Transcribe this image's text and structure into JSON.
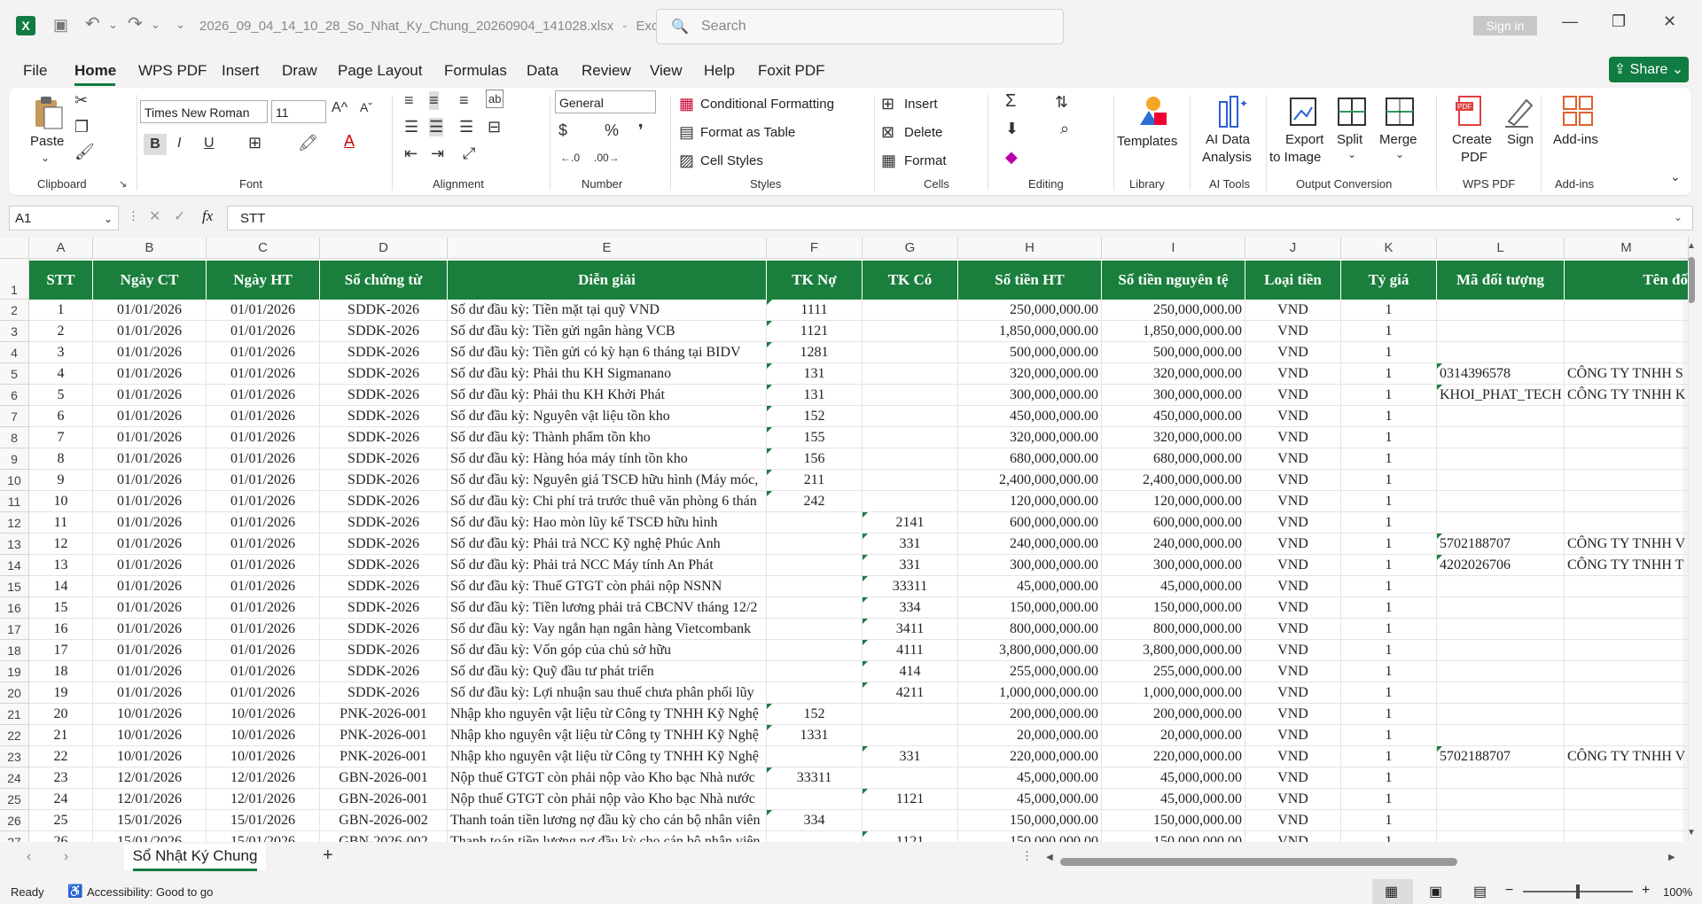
{
  "titlebar": {
    "app_icon": "X",
    "filename": "2026_09_04_14_10_28_So_Nhat_Ky_Chung_20260904_141028.xlsx",
    "separator": "-",
    "app_name": "Excel",
    "search_placeholder": "Search",
    "search_icon": "🔍",
    "signin": "Sign in",
    "save_icon": "▣",
    "undo_icon": "↶",
    "redo_icon": "↷",
    "dropdown_icon": "⌄",
    "min": "—",
    "max": "❐",
    "close": "✕"
  },
  "menu": {
    "items": [
      "File",
      "Home",
      "WPS PDF",
      "Insert",
      "Draw",
      "Page Layout",
      "Formulas",
      "Data",
      "Review",
      "View",
      "Help",
      "Foxit PDF"
    ],
    "active": "Home",
    "share": "Share"
  },
  "ribbon": {
    "clipboard": {
      "paste": "Paste",
      "label": "Clipboard"
    },
    "font": {
      "name": "Times New Roman",
      "size": "11",
      "label": "Font",
      "bold": "B",
      "italic": "I",
      "underline": "U",
      "grow": "A^",
      "shrink": "Aˇ"
    },
    "alignment": {
      "label": "Alignment"
    },
    "number": {
      "format": "General",
      "label": "Number",
      "currency": "$",
      "percent": "%",
      "comma": "❜"
    },
    "styles": {
      "conditional": "Conditional Formatting",
      "format_table": "Format as Table",
      "cell_styles": "Cell Styles",
      "label": "Styles"
    },
    "cells": {
      "insert": "Insert",
      "delete": "Delete",
      "format": "Format",
      "label": "Cells"
    },
    "editing": {
      "label": "Editing"
    },
    "library": {
      "templates": "Templates",
      "label": "Library"
    },
    "ai": {
      "line1": "AI Data",
      "line2": "Analysis",
      "label": "AI Tools"
    },
    "output": {
      "export1": "Export",
      "export2": "to Image",
      "split": "Split",
      "merge": "Merge",
      "label": "Output Conversion"
    },
    "wpspdf": {
      "create1": "Create",
      "create2": "PDF",
      "sign": "Sign",
      "label": "WPS PDF"
    },
    "addins": {
      "btn": "Add-ins",
      "label": "Add-ins"
    }
  },
  "formula": {
    "namebox": "A1",
    "fx": "fx",
    "value": "STT"
  },
  "columns": [
    "A",
    "B",
    "C",
    "D",
    "E",
    "F",
    "G",
    "H",
    "I",
    "J",
    "K",
    "L",
    "M"
  ],
  "headers": [
    "STT",
    "Ngày CT",
    "Ngày HT",
    "Số chứng từ",
    "Diễn giải",
    "TK Nợ",
    "TK Có",
    "Số tiền HT",
    "Số tiền nguyên tệ",
    "Loại tiền",
    "Tỷ giá",
    "Mã đối tượng",
    "Tên đố"
  ],
  "rows": [
    [
      "1",
      "01/01/2026",
      "01/01/2026",
      "SDDK-2026",
      "Số dư đầu kỳ: Tiền mặt tại quỹ VND",
      "1111",
      "",
      "250,000,000.00",
      "250,000,000.00",
      "VND",
      "1",
      "",
      ""
    ],
    [
      "2",
      "01/01/2026",
      "01/01/2026",
      "SDDK-2026",
      "Số dư đầu kỳ: Tiền gửi ngân hàng VCB",
      "1121",
      "",
      "1,850,000,000.00",
      "1,850,000,000.00",
      "VND",
      "1",
      "",
      ""
    ],
    [
      "3",
      "01/01/2026",
      "01/01/2026",
      "SDDK-2026",
      "Số dư đầu kỳ: Tiền gửi có kỳ hạn 6 tháng tại BIDV",
      "1281",
      "",
      "500,000,000.00",
      "500,000,000.00",
      "VND",
      "1",
      "",
      ""
    ],
    [
      "4",
      "01/01/2026",
      "01/01/2026",
      "SDDK-2026",
      "Số dư đầu kỳ: Phải thu KH Sigmanano",
      "131",
      "",
      "320,000,000.00",
      "320,000,000.00",
      "VND",
      "1",
      "0314396578",
      "CÔNG TY TNHH S"
    ],
    [
      "5",
      "01/01/2026",
      "01/01/2026",
      "SDDK-2026",
      "Số dư đầu kỳ: Phải thu KH Khởi Phát",
      "131",
      "",
      "300,000,000.00",
      "300,000,000.00",
      "VND",
      "1",
      "KHOI_PHAT_TECH",
      "CÔNG TY TNHH K"
    ],
    [
      "6",
      "01/01/2026",
      "01/01/2026",
      "SDDK-2026",
      "Số dư đầu kỳ: Nguyên vật liệu tồn kho",
      "152",
      "",
      "450,000,000.00",
      "450,000,000.00",
      "VND",
      "1",
      "",
      ""
    ],
    [
      "7",
      "01/01/2026",
      "01/01/2026",
      "SDDK-2026",
      "Số dư đầu kỳ: Thành phẩm tồn kho",
      "155",
      "",
      "320,000,000.00",
      "320,000,000.00",
      "VND",
      "1",
      "",
      ""
    ],
    [
      "8",
      "01/01/2026",
      "01/01/2026",
      "SDDK-2026",
      "Số dư đầu kỳ: Hàng hóa máy tính tồn kho",
      "156",
      "",
      "680,000,000.00",
      "680,000,000.00",
      "VND",
      "1",
      "",
      ""
    ],
    [
      "9",
      "01/01/2026",
      "01/01/2026",
      "SDDK-2026",
      "Số dư đầu kỳ: Nguyên giá TSCĐ hữu hình (Máy móc,",
      "211",
      "",
      "2,400,000,000.00",
      "2,400,000,000.00",
      "VND",
      "1",
      "",
      ""
    ],
    [
      "10",
      "01/01/2026",
      "01/01/2026",
      "SDDK-2026",
      "Số dư đầu kỳ: Chi phí trả trước thuê văn phòng 6 thán",
      "242",
      "",
      "120,000,000.00",
      "120,000,000.00",
      "VND",
      "1",
      "",
      ""
    ],
    [
      "11",
      "01/01/2026",
      "01/01/2026",
      "SDDK-2026",
      "Số dư đầu kỳ: Hao mòn lũy kế TSCĐ hữu hình",
      "",
      "2141",
      "600,000,000.00",
      "600,000,000.00",
      "VND",
      "1",
      "",
      ""
    ],
    [
      "12",
      "01/01/2026",
      "01/01/2026",
      "SDDK-2026",
      "Số dư đầu kỳ: Phải trả NCC Kỹ nghệ Phúc Anh",
      "",
      "331",
      "240,000,000.00",
      "240,000,000.00",
      "VND",
      "1",
      "5702188707",
      "CÔNG TY TNHH V"
    ],
    [
      "13",
      "01/01/2026",
      "01/01/2026",
      "SDDK-2026",
      "Số dư đầu kỳ: Phải trả NCC Máy tính An Phát",
      "",
      "331",
      "300,000,000.00",
      "300,000,000.00",
      "VND",
      "1",
      "4202026706",
      "CÔNG TY TNHH T"
    ],
    [
      "14",
      "01/01/2026",
      "01/01/2026",
      "SDDK-2026",
      "Số dư đầu kỳ: Thuế GTGT còn phải nộp NSNN",
      "",
      "33311",
      "45,000,000.00",
      "45,000,000.00",
      "VND",
      "1",
      "",
      ""
    ],
    [
      "15",
      "01/01/2026",
      "01/01/2026",
      "SDDK-2026",
      "Số dư đầu kỳ: Tiền lương phải trả CBCNV tháng 12/2",
      "",
      "334",
      "150,000,000.00",
      "150,000,000.00",
      "VND",
      "1",
      "",
      ""
    ],
    [
      "16",
      "01/01/2026",
      "01/01/2026",
      "SDDK-2026",
      "Số dư đầu kỳ: Vay ngắn hạn ngân hàng Vietcombank",
      "",
      "3411",
      "800,000,000.00",
      "800,000,000.00",
      "VND",
      "1",
      "",
      ""
    ],
    [
      "17",
      "01/01/2026",
      "01/01/2026",
      "SDDK-2026",
      "Số dư đầu kỳ: Vốn góp của chủ sở hữu",
      "",
      "4111",
      "3,800,000,000.00",
      "3,800,000,000.00",
      "VND",
      "1",
      "",
      ""
    ],
    [
      "18",
      "01/01/2026",
      "01/01/2026",
      "SDDK-2026",
      "Số dư đầu kỳ: Quỹ đầu tư phát triển",
      "",
      "414",
      "255,000,000.00",
      "255,000,000.00",
      "VND",
      "1",
      "",
      ""
    ],
    [
      "19",
      "01/01/2026",
      "01/01/2026",
      "SDDK-2026",
      "Số dư đầu kỳ: Lợi nhuận sau thuế chưa phân phối lũy",
      "",
      "4211",
      "1,000,000,000.00",
      "1,000,000,000.00",
      "VND",
      "1",
      "",
      ""
    ],
    [
      "20",
      "10/01/2026",
      "10/01/2026",
      "PNK-2026-001",
      "Nhập kho nguyên vật liệu từ Công ty TNHH Kỹ Nghệ",
      "152",
      "",
      "200,000,000.00",
      "200,000,000.00",
      "VND",
      "1",
      "",
      ""
    ],
    [
      "21",
      "10/01/2026",
      "10/01/2026",
      "PNK-2026-001",
      "Nhập kho nguyên vật liệu từ Công ty TNHH Kỹ Nghệ",
      "1331",
      "",
      "20,000,000.00",
      "20,000,000.00",
      "VND",
      "1",
      "",
      ""
    ],
    [
      "22",
      "10/01/2026",
      "10/01/2026",
      "PNK-2026-001",
      "Nhập kho nguyên vật liệu từ Công ty TNHH Kỹ Nghệ",
      "",
      "331",
      "220,000,000.00",
      "220,000,000.00",
      "VND",
      "1",
      "5702188707",
      "CÔNG TY TNHH V"
    ],
    [
      "23",
      "12/01/2026",
      "12/01/2026",
      "GBN-2026-001",
      "Nộp thuế GTGT còn phải nộp vào Kho bạc Nhà nước",
      "33311",
      "",
      "45,000,000.00",
      "45,000,000.00",
      "VND",
      "1",
      "",
      ""
    ],
    [
      "24",
      "12/01/2026",
      "12/01/2026",
      "GBN-2026-001",
      "Nộp thuế GTGT còn phải nộp vào Kho bạc Nhà nước",
      "",
      "1121",
      "45,000,000.00",
      "45,000,000.00",
      "VND",
      "1",
      "",
      ""
    ],
    [
      "25",
      "15/01/2026",
      "15/01/2026",
      "GBN-2026-002",
      "Thanh toán tiền lương nợ đầu kỳ cho cán bộ nhân viên",
      "334",
      "",
      "150,000,000.00",
      "150,000,000.00",
      "VND",
      "1",
      "",
      ""
    ],
    [
      "26",
      "15/01/2026",
      "15/01/2026",
      "GBN-2026-002",
      "Thanh toán tiền lương nợ đầu kỳ cho cán bộ nhân viên",
      "",
      "1121",
      "150,000,000.00",
      "150,000,000.00",
      "VND",
      "1",
      "",
      ""
    ]
  ],
  "sheet": {
    "tab": "Sổ Nhật Ký Chung",
    "add": "+"
  },
  "status": {
    "ready": "Ready",
    "accessibility": "Accessibility: Good to go",
    "zoom": "100%",
    "minus": "−",
    "plus": "+"
  }
}
